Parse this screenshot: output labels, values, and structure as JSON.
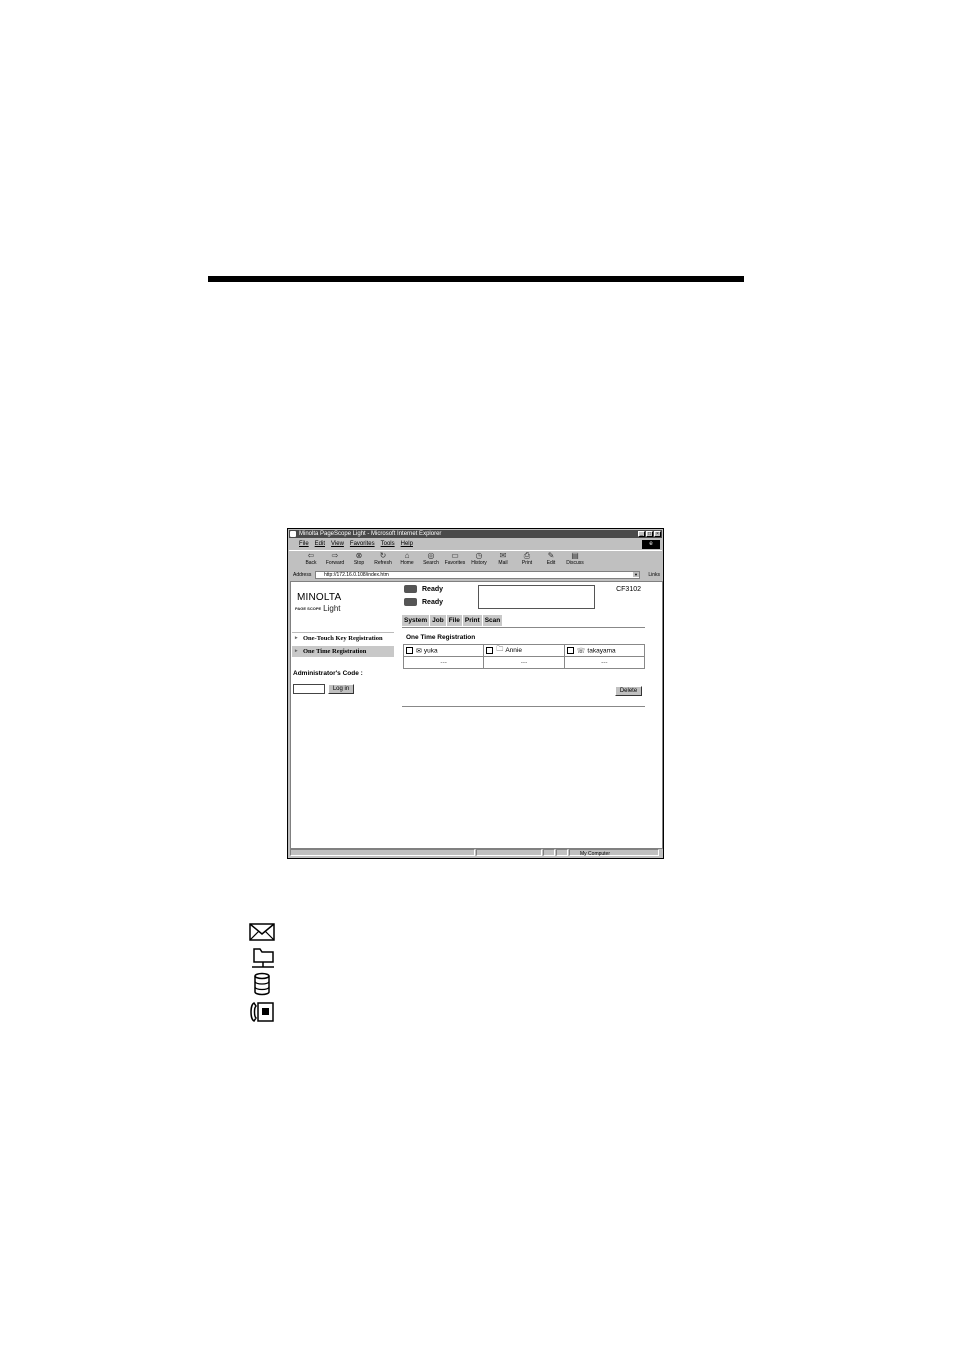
{
  "browser": {
    "title": "Minolta PageScope Light - Microsoft Internet Explorer",
    "menu": [
      "File",
      "Edit",
      "View",
      "Favorites",
      "Tools",
      "Help"
    ],
    "toolbar": [
      "Back",
      "Forward",
      "Stop",
      "Refresh",
      "Home",
      "Search",
      "Favorites",
      "History",
      "Mail",
      "Print",
      "Edit",
      "Discuss"
    ],
    "address_label": "Address",
    "address_value": "http://172.16.0.108/index.htm",
    "links_label": "Links",
    "status_zone": "My Computer"
  },
  "page": {
    "logo": "MINOLTA",
    "logo_sub_small": "PAGE SCOPE",
    "logo_sub": "Light",
    "status_1": "Ready",
    "status_2": "Ready",
    "model": "CF3102",
    "tabs": [
      "System",
      "Job",
      "File",
      "Print",
      "Scan"
    ],
    "nav": [
      "One-Touch Key Registration",
      "One Time Registration"
    ],
    "admin_label": "Administrator's Code :",
    "login_button": "Log in",
    "section_title": "One Time Registration",
    "entries": [
      {
        "name": "yuka",
        "icon": "mail-icon",
        "value": "---"
      },
      {
        "name": "Annie",
        "icon": "folder-icon",
        "value": "---"
      },
      {
        "name": "takayama",
        "icon": "fax-icon",
        "value": "---"
      }
    ],
    "delete_button": "Delete"
  },
  "legend_icons": [
    "mail-icon",
    "network-folder-icon",
    "database-icon",
    "fax-icon"
  ]
}
